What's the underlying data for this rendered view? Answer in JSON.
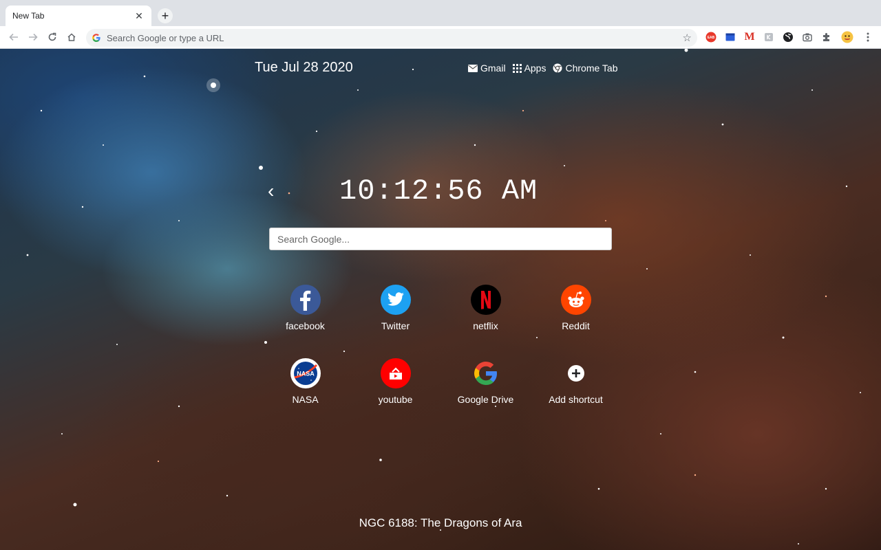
{
  "browser": {
    "tab_title": "New Tab",
    "omnibox_placeholder": "Search Google or type a URL",
    "extensions": [
      "eab-extension-icon",
      "blue-square-extension-icon",
      "gmail-m-extension-icon",
      "grey-extension-icon",
      "globe-extension-icon",
      "camera-extension-icon",
      "puzzle-extensions-icon",
      "profile-avatar-icon"
    ]
  },
  "page": {
    "date": "Tue Jul 28 2020",
    "links": {
      "gmail": "Gmail",
      "apps": "Apps",
      "chrome_tab": "Chrome Tab"
    },
    "clock": "10:12:56 AM",
    "search_placeholder": "Search Google...",
    "shortcuts": [
      {
        "label": "facebook",
        "icon": "facebook-icon",
        "color": "#3b5998"
      },
      {
        "label": "Twitter",
        "icon": "twitter-icon",
        "color": "#1da1f2"
      },
      {
        "label": "netflix",
        "icon": "netflix-icon",
        "color": "#000000"
      },
      {
        "label": "Reddit",
        "icon": "reddit-icon",
        "color": "#ff4500"
      },
      {
        "label": "NASA",
        "icon": "nasa-icon",
        "color": "#ffffff"
      },
      {
        "label": "youtube",
        "icon": "youtube-icon",
        "color": "#ff0000"
      },
      {
        "label": "Google Drive",
        "icon": "google-icon",
        "color": "transparent"
      },
      {
        "label": "Add shortcut",
        "icon": "add-shortcut-icon",
        "color": "transparent"
      }
    ],
    "caption": "NGC 6188: The Dragons of Ara"
  }
}
